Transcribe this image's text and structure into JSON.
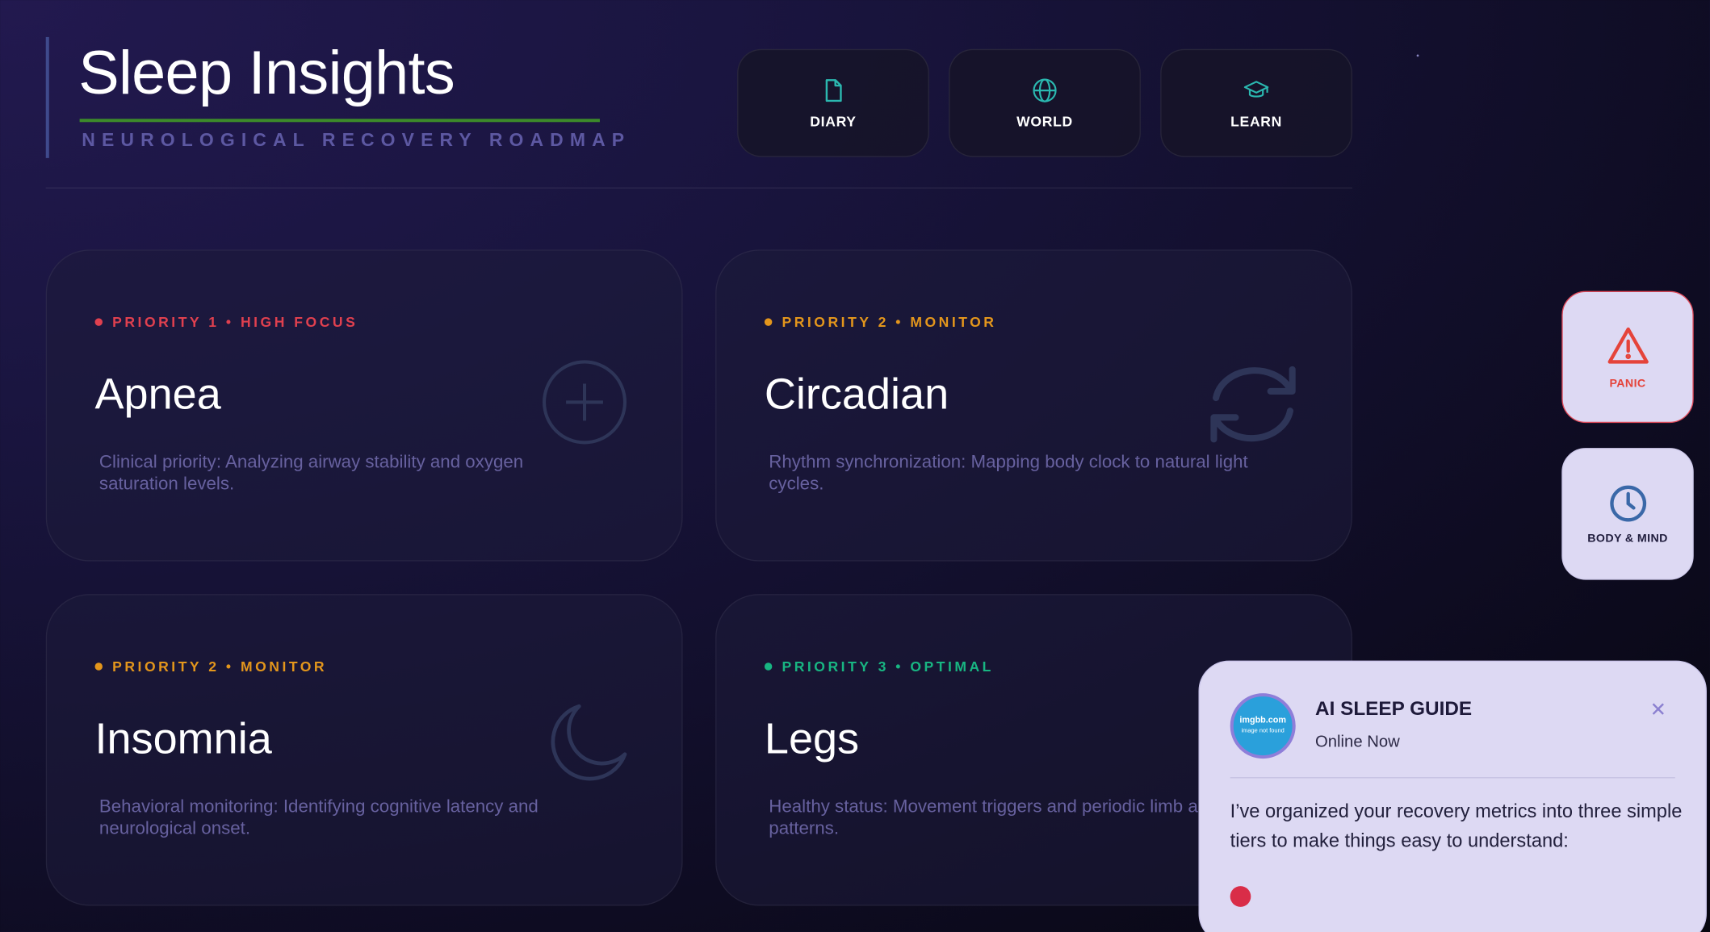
{
  "header": {
    "title": "Sleep Insights",
    "subtitle": "NEUROLOGICAL RECOVERY ROADMAP"
  },
  "nav": [
    {
      "label": "DIARY",
      "icon": "document-icon"
    },
    {
      "label": "WORLD",
      "icon": "globe-icon"
    },
    {
      "label": "LEARN",
      "icon": "graduation-cap-icon"
    }
  ],
  "cards": [
    {
      "tag": "PRIORITY 1 • HIGH FOCUS",
      "tag_color": "#e0404f",
      "name": "Apnea",
      "desc": "Clinical priority: Analyzing airway stability and oxygen saturation levels.",
      "icon": "plus-circle-icon"
    },
    {
      "tag": "PRIORITY 2 • MONITOR",
      "tag_color": "#e3961c",
      "name": "Circadian",
      "desc": "Rhythm synchronization: Mapping body clock to natural light cycles.",
      "icon": "refresh-icon"
    },
    {
      "tag": "PRIORITY 2 • MONITOR",
      "tag_color": "#e3961c",
      "name": "Insomnia",
      "desc": "Behavioral monitoring: Identifying cognitive latency and neurological onset.",
      "icon": "moon-icon"
    },
    {
      "tag": "PRIORITY 3 • OPTIMAL",
      "tag_color": "#18b582",
      "name": "Legs",
      "desc": "Healthy status: Movement triggers and periodic limb a patterns.",
      "icon": "none"
    }
  ],
  "side": {
    "panic_label": "PANIC",
    "body_label": "BODY & MIND"
  },
  "chat": {
    "avatar_line1": "imgbb.com",
    "avatar_line2": "image not found",
    "title": "AI SLEEP GUIDE",
    "status": "Online Now",
    "close": "✕",
    "message": "I’ve organized your recovery metrics into three simple tiers to make things easy to understand:"
  },
  "colors": {
    "accent_teal": "#2bb8b0",
    "danger": "#e5433a",
    "clock_blue": "#3a68a8"
  }
}
